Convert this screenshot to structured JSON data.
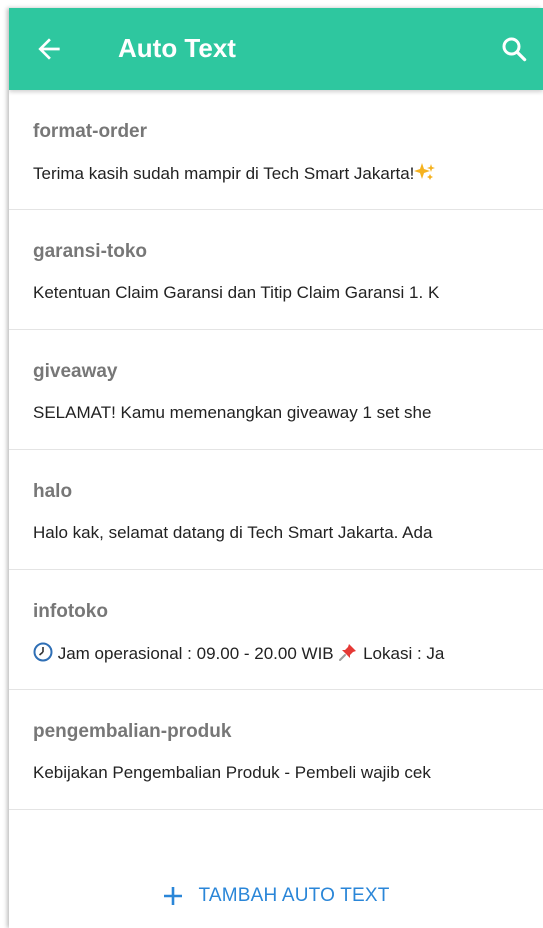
{
  "header": {
    "title": "Auto Text",
    "back_icon": "arrow-back-icon",
    "search_icon": "search-icon",
    "background_color": "#2ec79f"
  },
  "items": [
    {
      "name": "format-order",
      "preview": "Terima kasih sudah mampir di Tech Smart Jakarta!"
    },
    {
      "name": "garansi-toko",
      "preview": "Ketentuan Claim Garansi dan Titip Claim Garansi  1. K"
    },
    {
      "name": "giveaway",
      "preview": "SELAMAT!  Kamu memenangkan giveaway 1 set she"
    },
    {
      "name": "halo",
      "preview": "Halo kak, selamat datang di Tech Smart Jakarta. Ada"
    },
    {
      "name": "infotoko",
      "preview_part1": " Jam operasional : 09.00 - 20.00 WIB ",
      "preview_part2": " Lokasi : Ja"
    },
    {
      "name": "pengembalian-produk",
      "preview": "Kebijakan Pengembalian Produk  - Pembeli wajib cek"
    }
  ],
  "add_button": {
    "label": "TAMBAH AUTO TEXT",
    "color": "#2a86d8"
  }
}
